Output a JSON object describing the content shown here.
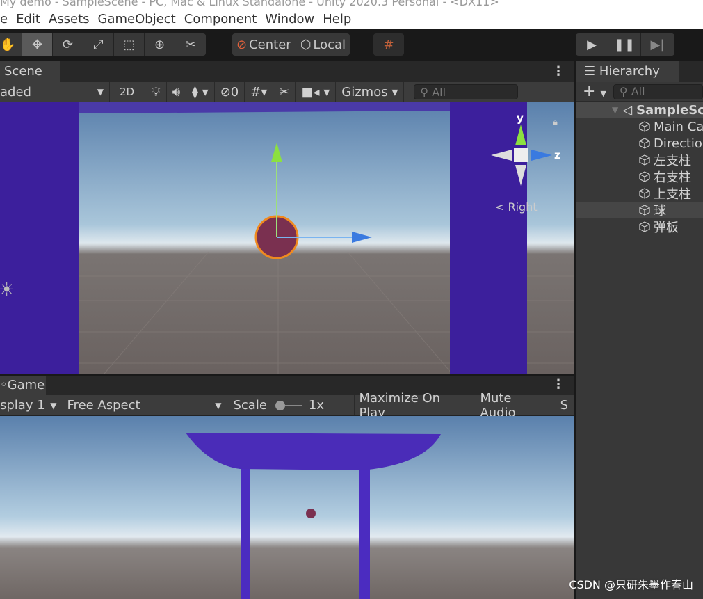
{
  "window": {
    "title": "My demo - SampleScene - PC, Mac & Linux Standalone - Unity 2020.3 Personal - <DX11>"
  },
  "menu": [
    "e",
    "Edit",
    "Assets",
    "GameObject",
    "Component",
    "Window",
    "Help"
  ],
  "toolbar": {
    "pivot_label": "Center",
    "space_label": "Local",
    "play_icon": "play-icon",
    "pause_icon": "pause-icon",
    "step_icon": "step-icon"
  },
  "scene": {
    "tab_label": "Scene",
    "shading": "aded",
    "mode_2d": "2D",
    "hidden_count": "0",
    "gizmos_label": "Gizmos",
    "search_placeholder": "All",
    "orientation_label": "< Right",
    "axis_y": "y",
    "axis_z": "z"
  },
  "game": {
    "tab_label": "Game",
    "display": "splay 1",
    "aspect": "Free Aspect",
    "scale_label": "Scale",
    "scale_value": "1x",
    "maximize": "Maximize On Play",
    "mute": "Mute Audio",
    "stats": "S"
  },
  "hierarchy": {
    "tab_label": "Hierarchy",
    "search_placeholder": "All",
    "scene_name": "SampleSc",
    "items": [
      "Main Ca",
      "Directio",
      "左支柱",
      "右支柱",
      "上支柱",
      "球",
      "弹板"
    ],
    "selected_index": 5
  },
  "watermark": "CSDN @只研朱墨作春山"
}
